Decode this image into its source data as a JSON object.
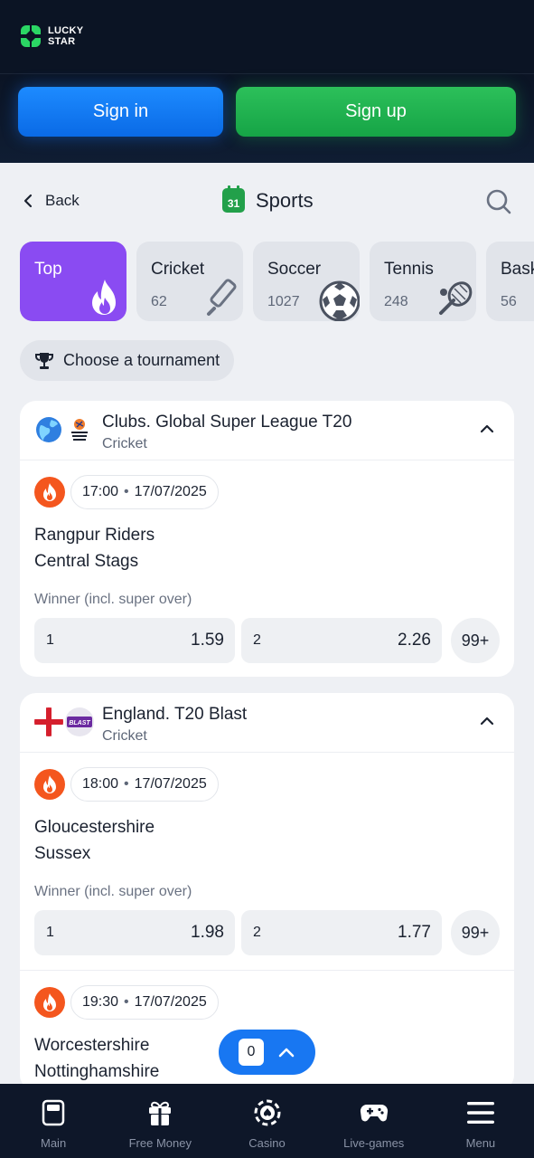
{
  "brand": {
    "line1": "LUCKY",
    "line2": "STAR"
  },
  "auth": {
    "signin": "Sign in",
    "signup": "Sign up"
  },
  "header": {
    "back": "Back",
    "title": "Sports",
    "calendar_day": "31"
  },
  "categories": [
    {
      "label": "Top",
      "count": "",
      "icon": "flame-icon"
    },
    {
      "label": "Cricket",
      "count": "62",
      "icon": "cricket-bat-icon"
    },
    {
      "label": "Soccer",
      "count": "1027",
      "icon": "soccer-ball-icon"
    },
    {
      "label": "Tennis",
      "count": "248",
      "icon": "tennis-racket-icon"
    },
    {
      "label": "Bask",
      "count": "56",
      "icon": "basketball-icon"
    }
  ],
  "tournament_button": "Choose a tournament",
  "leagues": [
    {
      "title": "Clubs. Global Super League T20",
      "sport": "Cricket",
      "events": [
        {
          "time": "17:00",
          "date": "17/07/2025",
          "team1": "Rangpur Riders",
          "team2": "Central Stags",
          "market": "Winner (incl. super over)",
          "odds": [
            {
              "k": "1",
              "v": "1.59"
            },
            {
              "k": "2",
              "v": "2.26"
            }
          ],
          "more": "99+"
        }
      ]
    },
    {
      "title": "England. T20 Blast",
      "sport": "Cricket",
      "events": [
        {
          "time": "18:00",
          "date": "17/07/2025",
          "team1": "Gloucestershire",
          "team2": "Sussex",
          "market": "Winner (incl. super over)",
          "odds": [
            {
              "k": "1",
              "v": "1.98"
            },
            {
              "k": "2",
              "v": "1.77"
            }
          ],
          "more": "99+"
        },
        {
          "time": "19:30",
          "date": "17/07/2025",
          "team1": "Worcestershire",
          "team2": "Nottinghamshire"
        }
      ]
    }
  ],
  "betslip": {
    "count": "0"
  },
  "nav": [
    {
      "label": "Main",
      "icon": "main-icon"
    },
    {
      "label": "Free Money",
      "icon": "gift-icon"
    },
    {
      "label": "Casino",
      "icon": "casino-chip-icon"
    },
    {
      "label": "Live-games",
      "icon": "gamepad-icon"
    },
    {
      "label": "Menu",
      "icon": "hamburger-icon"
    }
  ],
  "colors": {
    "accent_blue": "#1877f2",
    "accent_green": "#22a04a",
    "top_purple": "#8a4bf2",
    "hot_orange": "#f4561e"
  }
}
